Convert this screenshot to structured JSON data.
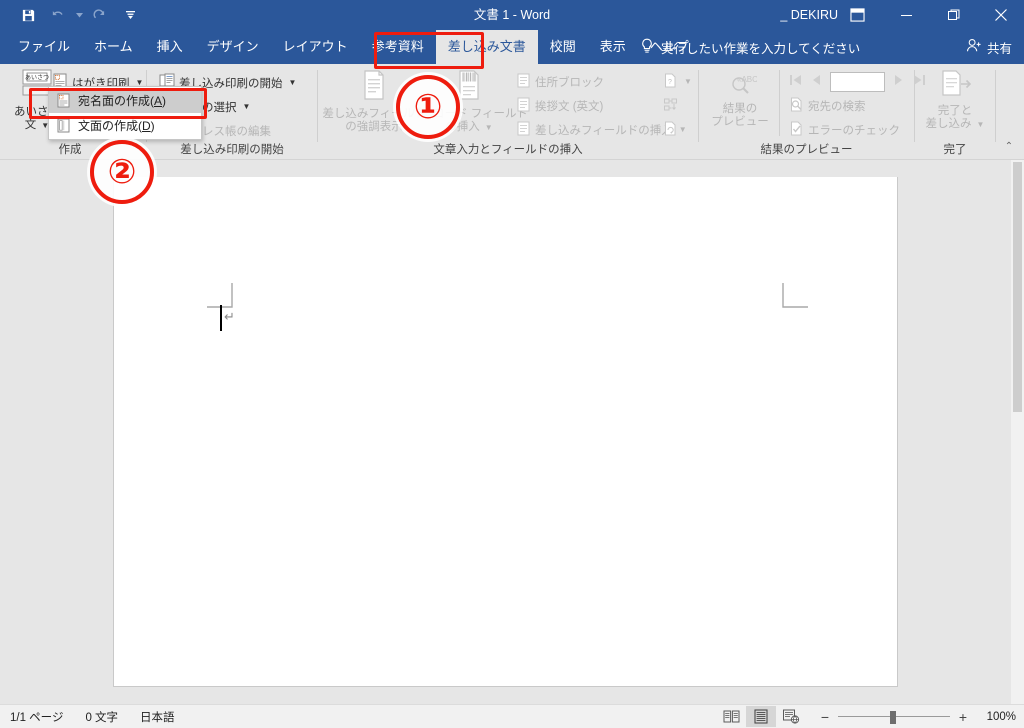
{
  "window": {
    "title": "文書 1 - Word",
    "account": "_ DEKIRU",
    "ribbon_display_icon": "ribbon-display-options-icon",
    "minimize": "—",
    "restore": "❐",
    "close": "✕"
  },
  "quick_access": [
    {
      "name": "save-icon",
      "label": "保存"
    },
    {
      "name": "undo-icon",
      "label": "元に戻す"
    },
    {
      "name": "redo-icon",
      "label": "やり直し"
    },
    {
      "name": "customize-qat-icon",
      "label": "クイック アクセス ツール バーのユーザー設定"
    }
  ],
  "tabs": [
    {
      "label": "ファイル",
      "active": false
    },
    {
      "label": "ホーム",
      "active": false
    },
    {
      "label": "挿入",
      "active": false
    },
    {
      "label": "デザイン",
      "active": false
    },
    {
      "label": "レイアウト",
      "active": false
    },
    {
      "label": "参考資料",
      "active": false
    },
    {
      "label": "差し込み文書",
      "active": true
    },
    {
      "label": "校閲",
      "active": false
    },
    {
      "label": "表示",
      "active": false
    },
    {
      "label": "ヘルプ",
      "active": false
    }
  ],
  "tell_me": {
    "icon": "lightbulb-icon",
    "placeholder": "実行したい作業を入力してください"
  },
  "share": {
    "icon": "share-person-icon",
    "label": "共有"
  },
  "ribbon": {
    "groups": [
      {
        "name": "作成",
        "label": "作成",
        "buttons": [
          {
            "name": "greeting-text-button",
            "label_lines": [
              "あいさつ",
              "文"
            ],
            "caret": true,
            "enabled": true
          },
          {
            "name": "postcard-print-button",
            "label_lines": [
              "はがき印刷"
            ],
            "caret": true,
            "enabled": true
          }
        ]
      },
      {
        "name": "差し込み印刷の開始",
        "label": "差し込み印刷の開始",
        "buttons": [
          {
            "name": "start-mail-merge-button",
            "label_lines": [
              "差し込み印刷の開始"
            ],
            "caret": true,
            "enabled": true
          },
          {
            "name": "select-recipients-button",
            "label_lines": [
              "宛先の選択"
            ],
            "caret": true,
            "enabled": true
          },
          {
            "name": "edit-recipient-list-button",
            "label_lines": [
              "アドレス帳の編集"
            ],
            "caret": false,
            "enabled": false
          }
        ]
      },
      {
        "name": "文章入力とフィールドの挿入",
        "label": "文章入力とフィールドの挿入",
        "buttons": [
          {
            "name": "highlight-merge-fields-button",
            "label_lines": [
              "差し込みフィールド",
              "の強調表示"
            ],
            "caret": false,
            "enabled": false
          },
          {
            "name": "address-block-button",
            "label_lines": [
              "住所ブロック"
            ],
            "caret": false,
            "enabled": false
          },
          {
            "name": "greeting-line-button",
            "label_lines": [
              "挨拶文 (英文)"
            ],
            "caret": false,
            "enabled": false
          },
          {
            "name": "insert-merge-field-button",
            "label_lines": [
              "差し込みフィールドの挿入"
            ],
            "caret": true,
            "enabled": false
          },
          {
            "name": "barcode-field-button",
            "label_lines": [
              "バーコード フィールド",
              "の挿入"
            ],
            "caret": true,
            "enabled": false
          },
          {
            "name": "rules-button",
            "label_lines": [
              ""
            ],
            "caret": true,
            "enabled": false
          },
          {
            "name": "match-fields-button",
            "label_lines": [
              ""
            ],
            "caret": false,
            "enabled": false
          },
          {
            "name": "update-labels-button",
            "label_lines": [
              ""
            ],
            "caret": false,
            "enabled": false
          }
        ]
      },
      {
        "name": "結果のプレビュー",
        "label": "結果のプレビュー",
        "buttons": [
          {
            "name": "preview-results-button",
            "label_lines": [
              "結果の",
              "プレビュー"
            ],
            "caret": false,
            "enabled": false
          },
          {
            "name": "first-record-button",
            "label_lines": [
              ""
            ],
            "caret": false,
            "enabled": false
          },
          {
            "name": "previous-record-button",
            "label_lines": [
              ""
            ],
            "caret": false,
            "enabled": false
          },
          {
            "name": "record-number-input",
            "value": "",
            "enabled": false
          },
          {
            "name": "next-record-button",
            "label_lines": [
              ""
            ],
            "caret": false,
            "enabled": false
          },
          {
            "name": "last-record-button",
            "label_lines": [
              ""
            ],
            "caret": false,
            "enabled": false
          },
          {
            "name": "find-recipient-button",
            "label_lines": [
              "宛先の検索"
            ],
            "caret": false,
            "enabled": false
          },
          {
            "name": "check-errors-button",
            "label_lines": [
              "エラーのチェック"
            ],
            "caret": false,
            "enabled": false
          }
        ]
      },
      {
        "name": "完了",
        "label": "完了",
        "buttons": [
          {
            "name": "finish-and-merge-button",
            "label_lines": [
              "完了と",
              "差し込み"
            ],
            "caret": true,
            "enabled": false
          }
        ]
      }
    ],
    "collapse_label": "⌃"
  },
  "dropdown": {
    "items": [
      {
        "name": "create-address-side",
        "label_prefix": "宛名面の作成(",
        "accel": "A",
        "label_suffix": ")",
        "selected": true,
        "icon": "address-side-icon"
      },
      {
        "name": "create-message-side",
        "label_prefix": "文面の作成(",
        "accel": "D",
        "label_suffix": ")",
        "selected": false,
        "icon": "message-side-icon"
      }
    ]
  },
  "callouts": [
    {
      "name": "callout-1",
      "number": "①",
      "target": "差し込み文書 tab"
    },
    {
      "name": "callout-2",
      "number": "②",
      "target": "宛名面の作成(A)"
    }
  ],
  "accent_colors": {
    "word_blue": "#2b579a",
    "callout_red": "#ee1c0e",
    "ribbon_bg": "#e6e6e6",
    "page_bg": "#ffffff"
  },
  "status_bar": {
    "page_info": "1/1 ページ",
    "word_count": "0 文字",
    "language": "日本語",
    "views": [
      {
        "name": "read-mode-view-button",
        "icon": "read-mode-icon",
        "active": false
      },
      {
        "name": "print-layout-view-button",
        "icon": "print-layout-icon",
        "active": true
      },
      {
        "name": "web-layout-view-button",
        "icon": "web-layout-icon",
        "active": false
      }
    ],
    "zoom": {
      "minus": "−",
      "plus": "+",
      "value": "100%",
      "percent": 100
    }
  }
}
